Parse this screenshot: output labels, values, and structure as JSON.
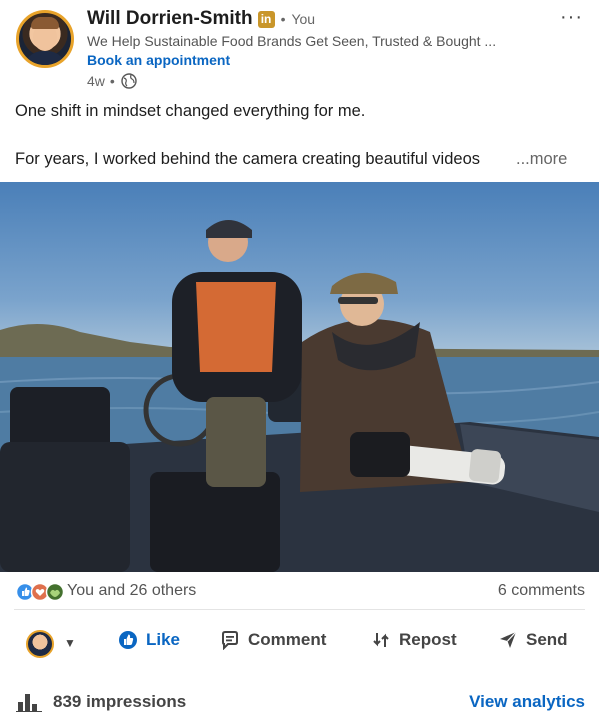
{
  "post": {
    "author": {
      "name": "Will Dorrien-Smith",
      "badge": "in",
      "separator": "•",
      "you_label": "You",
      "headline": "We Help Sustainable Food Brands Get Seen, Trusted & Bought ...",
      "cta_link": "Book an appointment",
      "age": "4w",
      "age_separator": "•",
      "visibility_icon": "globe-icon"
    },
    "menu_icon": "more-icon",
    "text_line1": "One shift in mindset changed everything for me.",
    "text_line2": "For years, I worked behind the camera creating beautiful videos",
    "see_more": "...more",
    "image_icon": "photo"
  },
  "social": {
    "reactions_text": "You and 26 others",
    "comments_text": "6 comments",
    "reaction_icons": [
      "like-reaction-icon",
      "love-reaction-icon",
      "support-reaction-icon"
    ]
  },
  "actions": {
    "like": "Like",
    "comment": "Comment",
    "repost": "Repost",
    "send": "Send"
  },
  "analytics": {
    "impressions": "839 impressions",
    "link": "View analytics"
  },
  "colors": {
    "accent": "#0a66c2",
    "badge": "#c9962a",
    "avatar_ring": "#e8a32a"
  }
}
